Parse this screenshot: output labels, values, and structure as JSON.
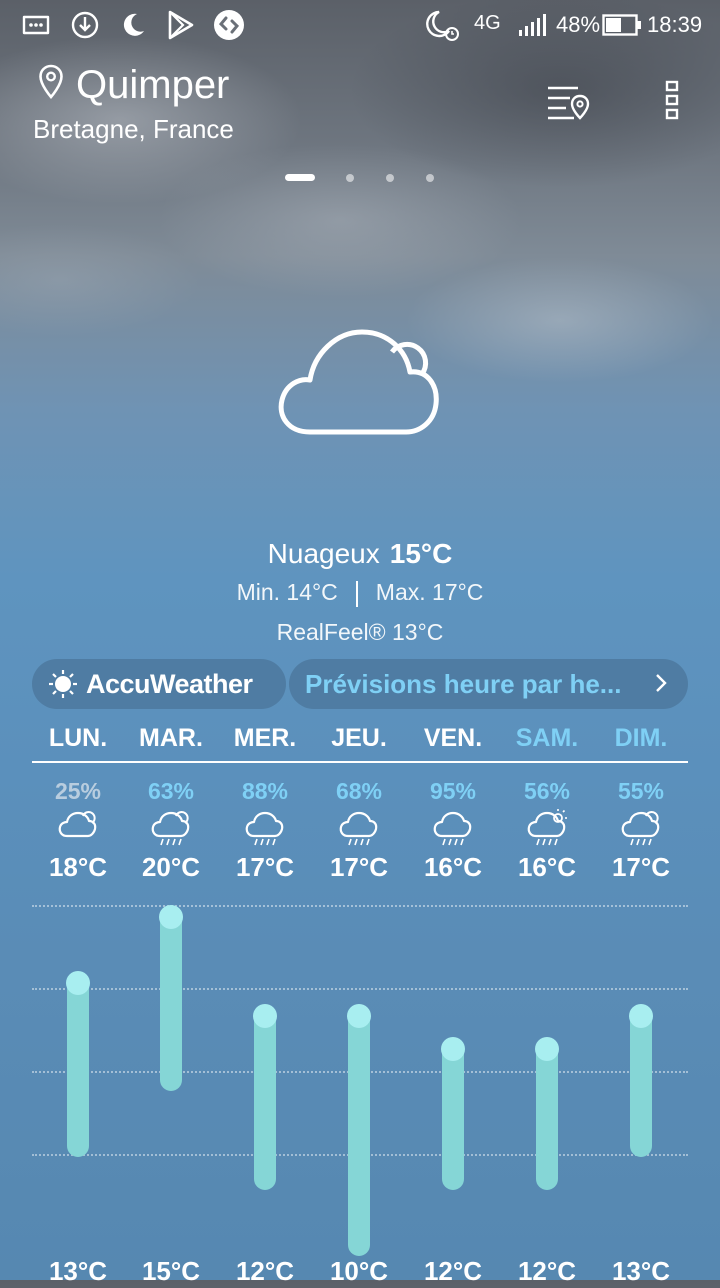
{
  "status_bar": {
    "left_icons": [
      "message-icon",
      "download-icon",
      "moon-icon",
      "play-store-icon",
      "shazam-icon"
    ],
    "right_icons": [
      "alarm-moon-icon",
      "signal-icon",
      "battery-icon"
    ],
    "network": "4G",
    "battery": "48%",
    "time": "18:39"
  },
  "header": {
    "city": "Quimper",
    "region": "Bretagne, France",
    "pages": 4,
    "active_page": 0
  },
  "current": {
    "icon": "cloud-icon",
    "condition": "Nuageux",
    "temperature": "15°C",
    "min": "Min. 14°C",
    "max": "Max. 17°C",
    "realfeel": "RealFeel® 13°C"
  },
  "accuweather": {
    "label": "AccuWeather"
  },
  "hourly": {
    "label": "Prévisions heure par he..."
  },
  "forecast": [
    {
      "day": "LUN.",
      "weekend": false,
      "precip": "25%",
      "precip_dim": true,
      "icon": "cloudy-icon",
      "high": "18°C",
      "low": "13°C",
      "high_val": 18,
      "low_val": 13
    },
    {
      "day": "MAR.",
      "weekend": false,
      "precip": "63%",
      "precip_dim": false,
      "icon": "rain-cloud-icon",
      "high": "20°C",
      "low": "15°C",
      "high_val": 20,
      "low_val": 15
    },
    {
      "day": "MER.",
      "weekend": false,
      "precip": "88%",
      "precip_dim": false,
      "icon": "rain-icon",
      "high": "17°C",
      "low": "12°C",
      "high_val": 17,
      "low_val": 12
    },
    {
      "day": "JEU.",
      "weekend": false,
      "precip": "68%",
      "precip_dim": false,
      "icon": "rain-icon",
      "high": "17°C",
      "low": "10°C",
      "high_val": 17,
      "low_val": 10
    },
    {
      "day": "VEN.",
      "weekend": false,
      "precip": "95%",
      "precip_dim": false,
      "icon": "rain-icon",
      "high": "16°C",
      "low": "12°C",
      "high_val": 16,
      "low_val": 12
    },
    {
      "day": "SAM.",
      "weekend": true,
      "precip": "56%",
      "precip_dim": false,
      "icon": "sun-rain-icon",
      "high": "16°C",
      "low": "12°C",
      "high_val": 16,
      "low_val": 12
    },
    {
      "day": "DIM.",
      "weekend": true,
      "precip": "55%",
      "precip_dim": false,
      "icon": "rain-cloud-icon",
      "high": "17°C",
      "low": "13°C",
      "high_val": 17,
      "low_val": 13
    }
  ],
  "colors": {
    "accent": "#7fd0f5",
    "bar": "#85d6d6",
    "bar_cap": "#a8eef0"
  }
}
